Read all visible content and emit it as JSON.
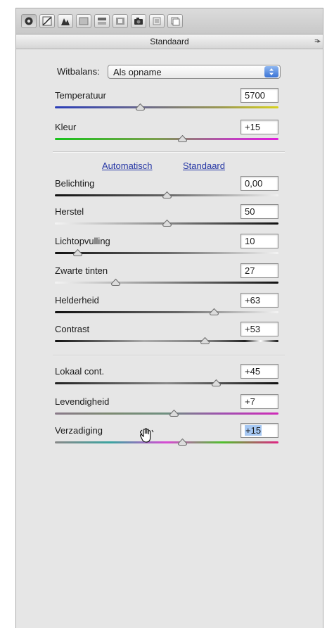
{
  "panel": {
    "title": "Standaard",
    "white_balance": {
      "label": "Witbalans:",
      "value": "Als opname"
    },
    "auto_link": "Automatisch",
    "default_link": "Standaard"
  },
  "toolbar": {
    "tools": [
      "basic-icon",
      "tone-curve-icon",
      "detail-icon",
      "hsl-icon",
      "split-toning-icon",
      "lens-corrections-icon",
      "camera-calibration-icon",
      "presets-icon",
      "snapshots-icon"
    ]
  },
  "sliders": [
    {
      "label": "Temperatuur",
      "value": "5700",
      "position": 0.38
    },
    {
      "label": "Kleur",
      "value": "+15",
      "position": 0.57
    },
    {
      "label": "Belichting",
      "value": "0,00",
      "position": 0.5
    },
    {
      "label": "Herstel",
      "value": "50",
      "position": 0.5
    },
    {
      "label": "Lichtopvulling",
      "value": "10",
      "position": 0.1
    },
    {
      "label": "Zwarte tinten",
      "value": "27",
      "position": 0.27
    },
    {
      "label": "Helderheid",
      "value": "+63",
      "position": 0.71
    },
    {
      "label": "Contrast",
      "value": "+53",
      "position": 0.67
    },
    {
      "label": "Lokaal cont.",
      "value": "+45",
      "position": 0.72
    },
    {
      "label": "Levendigheid",
      "value": "+7",
      "position": 0.53
    },
    {
      "label": "Verzadiging",
      "value": "+15",
      "position": 0.57,
      "selected": true
    }
  ],
  "colors": {
    "link": "#2637a5",
    "selection": "#a6c8f3",
    "popup_arrows": "#3a73d6"
  }
}
